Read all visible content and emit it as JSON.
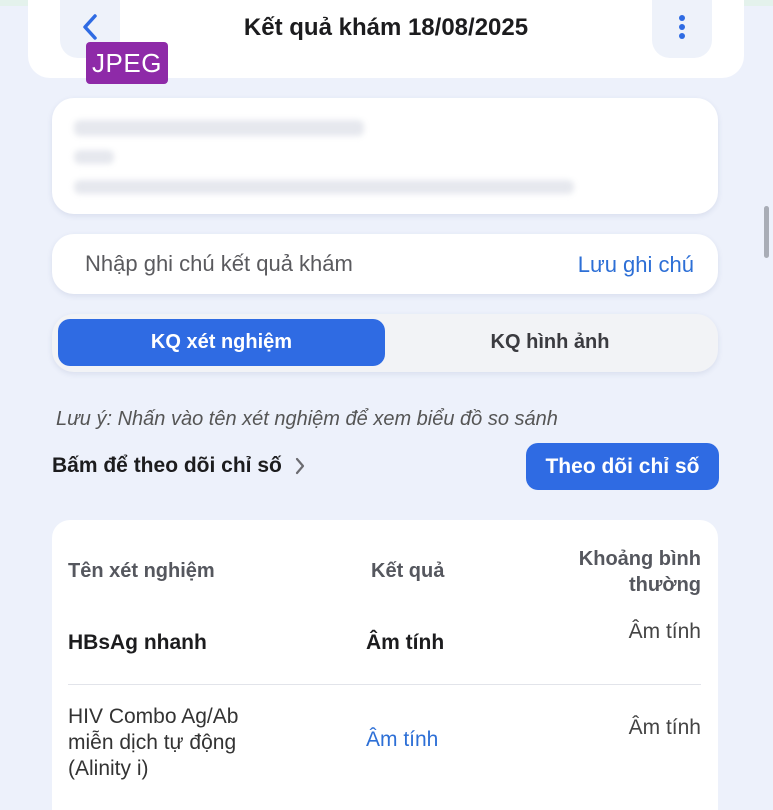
{
  "header": {
    "title": "Kết quả khám 18/08/2025",
    "back_icon": "chevron-left-icon",
    "more_icon": "kebab-menu-icon",
    "badge": "JPEG"
  },
  "note": {
    "placeholder": "Nhập ghi chú kết quả khám",
    "save_label": "Lưu ghi chú"
  },
  "tabs": [
    {
      "label": "KQ xét nghiệm",
      "active": true
    },
    {
      "label": "KQ hình ảnh",
      "active": false
    }
  ],
  "hint": "Lưu ý: Nhấn vào tên xét nghiệm để xem biểu đồ so sánh",
  "follow": {
    "link_label": "Bấm để theo dõi chỉ số",
    "button_label": "Theo dõi chỉ số"
  },
  "results": {
    "headers": {
      "name": "Tên xét nghiệm",
      "result": "Kết quả",
      "range_line1": "Khoảng bình",
      "range_line2": "thường"
    },
    "rows": [
      {
        "name": "HBsAg nhanh",
        "result": "Âm tính",
        "range": "Âm tính"
      },
      {
        "name_line1": "HIV Combo Ag/Ab",
        "name_line2": "miễn dịch tự động",
        "name_line3": "(Alinity i)",
        "result": "Âm tính",
        "range": "Âm tính"
      }
    ]
  },
  "colors": {
    "accent": "#2f6be3",
    "link": "#2d6fd6",
    "badge": "#8e2aa8",
    "background": "#edf1fb"
  }
}
